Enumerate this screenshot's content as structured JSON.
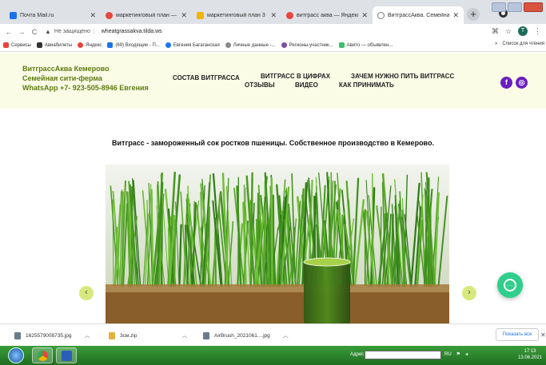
{
  "browser": {
    "tabs": [
      {
        "title": "Почта Mail.ru",
        "color": "#1a73e8"
      },
      {
        "title": "маркетинговый план — Янде",
        "color": "#e8453c"
      },
      {
        "title": "маркетинговый план 3 тыс с",
        "color": "#f0b400"
      },
      {
        "title": "витграсс аква — Яндекс: нос",
        "color": "#e8453c"
      },
      {
        "title": "ВитграссАква. Семейная сит",
        "color": "#777777",
        "active": true
      }
    ],
    "new_tab": "+",
    "address": {
      "security_label": "Не защищено",
      "url": "wheatgrassakva.tilda.ws"
    },
    "profile_initial": "T"
  },
  "bookmarks": {
    "items": [
      {
        "label": "Сервисы",
        "color": "#e8453c"
      },
      {
        "label": "Авиабилеты",
        "color": "#333333"
      },
      {
        "label": "Яндекс",
        "color": "#e8453c"
      },
      {
        "label": "(69) Входящие - П...",
        "color": "#1a73e8"
      },
      {
        "label": "Евгения Багаганская",
        "color": "#1877f2"
      },
      {
        "label": "Личные данные -...",
        "color": "#888888"
      },
      {
        "label": "Регионы-участник...",
        "color": "#7a4fa0"
      },
      {
        "label": "Авито — объявлен...",
        "color": "#3fbf6b"
      }
    ],
    "more": "»",
    "reading_list": "Список для чтения"
  },
  "site": {
    "brand_line1": "ВитграссАква Кемерово",
    "brand_line2": "Семейная сити-ферма",
    "brand_line3": "WhatsApp +7- 923-505-8946 Евгения",
    "menu": {
      "composition": "СОСТАВ ВИТГРАССА",
      "numbers": "ВИТГРАСС В ЦИФРАХ",
      "why": "ЗАЧЕМ НУЖНО ПИТЬ ВИТГРАСС",
      "reviews": "ОТЗЫВЫ",
      "video": "ВИДЕО",
      "how_to": "КАК ПРИНИМАТЬ"
    },
    "social": {
      "facebook": "f",
      "instagram": "◎"
    },
    "headline": "Витграсс - замороженный сок ростков пшеницы. Собственное производство в Кемерово.",
    "slider_prev": "‹",
    "slider_next": "›"
  },
  "downloads": {
    "items": [
      {
        "name": "1625579008735.jpg"
      },
      {
        "name": "3см.zip"
      },
      {
        "name": "AirBrush_2021061....jpg"
      }
    ],
    "show_all": "Показать все",
    "close": "✕"
  },
  "taskbar": {
    "address_label": "Адрес",
    "lang": "RU",
    "time": "17:13",
    "date": "13.06.2021"
  }
}
